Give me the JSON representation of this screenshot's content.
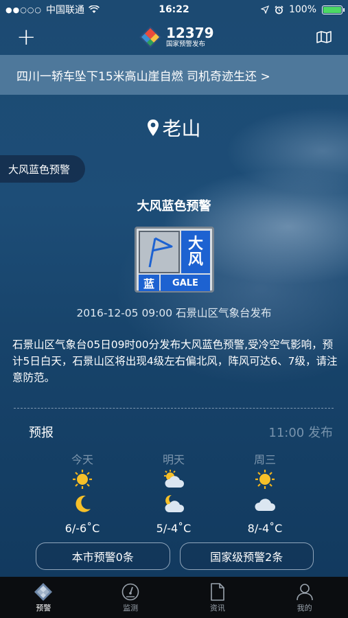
{
  "status_bar": {
    "signal_dots": "●●○○○",
    "carrier": "中国联通",
    "time": "16:22",
    "battery": "100%",
    "battery_level": 1.0
  },
  "nav": {
    "logo_number": "12379",
    "logo_subtitle": "国家预警发布",
    "icons": [
      "plus-icon",
      "map-icon"
    ]
  },
  "news": {
    "headline": "四川一轿车坠下15米高山崖自燃 司机奇迹生还 >"
  },
  "location": {
    "name": "老山"
  },
  "alert": {
    "tag": "大风蓝色预警",
    "title": "大风蓝色预警",
    "badge_char1": "大",
    "badge_char2": "风",
    "badge_level": "蓝",
    "badge_en": "GALE",
    "issued": "2016-12-05 09:00 石景山区气象台发布",
    "description": "石景山区气象台05日09时00分发布大风蓝色预警,受冷空气影响，预计5日白天，石景山区将出现4级左右偏北风，阵风可达6、7级，请注意防范。",
    "colors": {
      "level_blue": "#1d62d1"
    }
  },
  "forecast": {
    "label": "预报",
    "published": "11:00 发布",
    "days": [
      {
        "name": "今天",
        "day_icon": "sun-icon",
        "night_icon": "moon-icon",
        "temp": "6/-6˚C"
      },
      {
        "name": "明天",
        "day_icon": "partly-cloudy-icon",
        "night_icon": "partly-cloudy-night-icon",
        "temp": "5/-4˚C"
      },
      {
        "name": "周三",
        "day_icon": "sun-icon",
        "night_icon": "cloud-icon",
        "temp": "8/-4˚C"
      }
    ]
  },
  "buttons": {
    "city_alerts": "本市预警0条",
    "national_alerts": "国家级预警2条"
  },
  "tabs": [
    {
      "label": "预警",
      "icon": "alert-diamond-icon",
      "active": true
    },
    {
      "label": "监测",
      "icon": "gauge-icon",
      "active": false
    },
    {
      "label": "资讯",
      "icon": "document-icon",
      "active": false
    },
    {
      "label": "我的",
      "icon": "person-icon",
      "active": false
    }
  ]
}
